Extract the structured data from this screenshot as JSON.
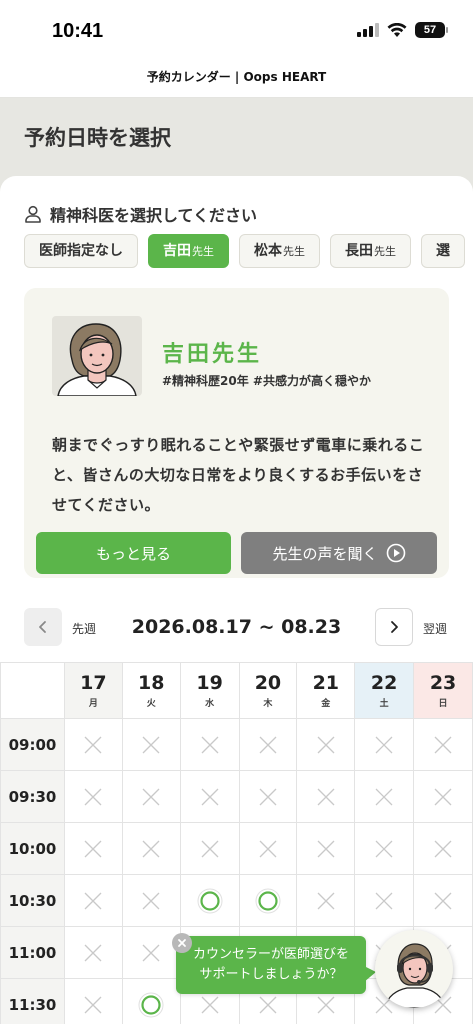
{
  "status_bar": {
    "time": "10:41",
    "battery": "57"
  },
  "nav": {
    "title": "予約カレンダー | Oops HEART"
  },
  "page": {
    "title": "予約日時を選択"
  },
  "doctor_select": {
    "heading": "精神科医を選択してください",
    "tabs": [
      {
        "label": "医師指定なし",
        "suffix": "",
        "active": false
      },
      {
        "label": "吉田",
        "suffix": "先生",
        "active": true
      },
      {
        "label": "松本",
        "suffix": "先生",
        "active": false
      },
      {
        "label": "長田",
        "suffix": "先生",
        "active": false
      },
      {
        "label": "選",
        "suffix": "",
        "active": false
      }
    ]
  },
  "profile": {
    "name": "吉田先生",
    "tags": "#精神科歴20年  #共感力が高く穏やか",
    "description": "朝までぐっすり眠れることや緊張せず電車に乗れること、皆さんの大切な日常をより良くするお手伝いをさせてください。",
    "more_button": "もっと見る",
    "voice_button": "先生の声を聞く"
  },
  "week": {
    "prev_label": "先週",
    "next_label": "翌週",
    "range": "2026.08.17 ~ 08.23"
  },
  "calendar": {
    "days": [
      {
        "date": "17",
        "weekday": "月",
        "kind": "weekday"
      },
      {
        "date": "18",
        "weekday": "火",
        "kind": "weekday"
      },
      {
        "date": "19",
        "weekday": "水",
        "kind": "weekday"
      },
      {
        "date": "20",
        "weekday": "木",
        "kind": "weekday"
      },
      {
        "date": "21",
        "weekday": "金",
        "kind": "weekday"
      },
      {
        "date": "22",
        "weekday": "土",
        "kind": "saturday"
      },
      {
        "date": "23",
        "weekday": "日",
        "kind": "sunday"
      }
    ],
    "rows": [
      {
        "time": "09:00",
        "slots": [
          "x",
          "x",
          "x",
          "x",
          "x",
          "x",
          "x"
        ]
      },
      {
        "time": "09:30",
        "slots": [
          "x",
          "x",
          "x",
          "x",
          "x",
          "x",
          "x"
        ]
      },
      {
        "time": "10:00",
        "slots": [
          "x",
          "x",
          "x",
          "x",
          "x",
          "x",
          "x"
        ]
      },
      {
        "time": "10:30",
        "slots": [
          "x",
          "x",
          "o",
          "o",
          "x",
          "x",
          "x"
        ]
      },
      {
        "time": "11:00",
        "slots": [
          "x",
          "x",
          "x",
          "x",
          "x",
          "x",
          "x"
        ]
      },
      {
        "time": "11:30",
        "slots": [
          "x",
          "o",
          "x",
          "x",
          "x",
          "x",
          "x"
        ]
      }
    ]
  },
  "help": {
    "bubble_line1": "カウンセラーが医師選びを",
    "bubble_line2": "サポートしましょうか？"
  },
  "colors": {
    "accent": "#5bb54a",
    "gray_button": "#7f7f7f",
    "saturday_bg": "#e6f1f7",
    "sunday_bg": "#fbe8e6"
  }
}
